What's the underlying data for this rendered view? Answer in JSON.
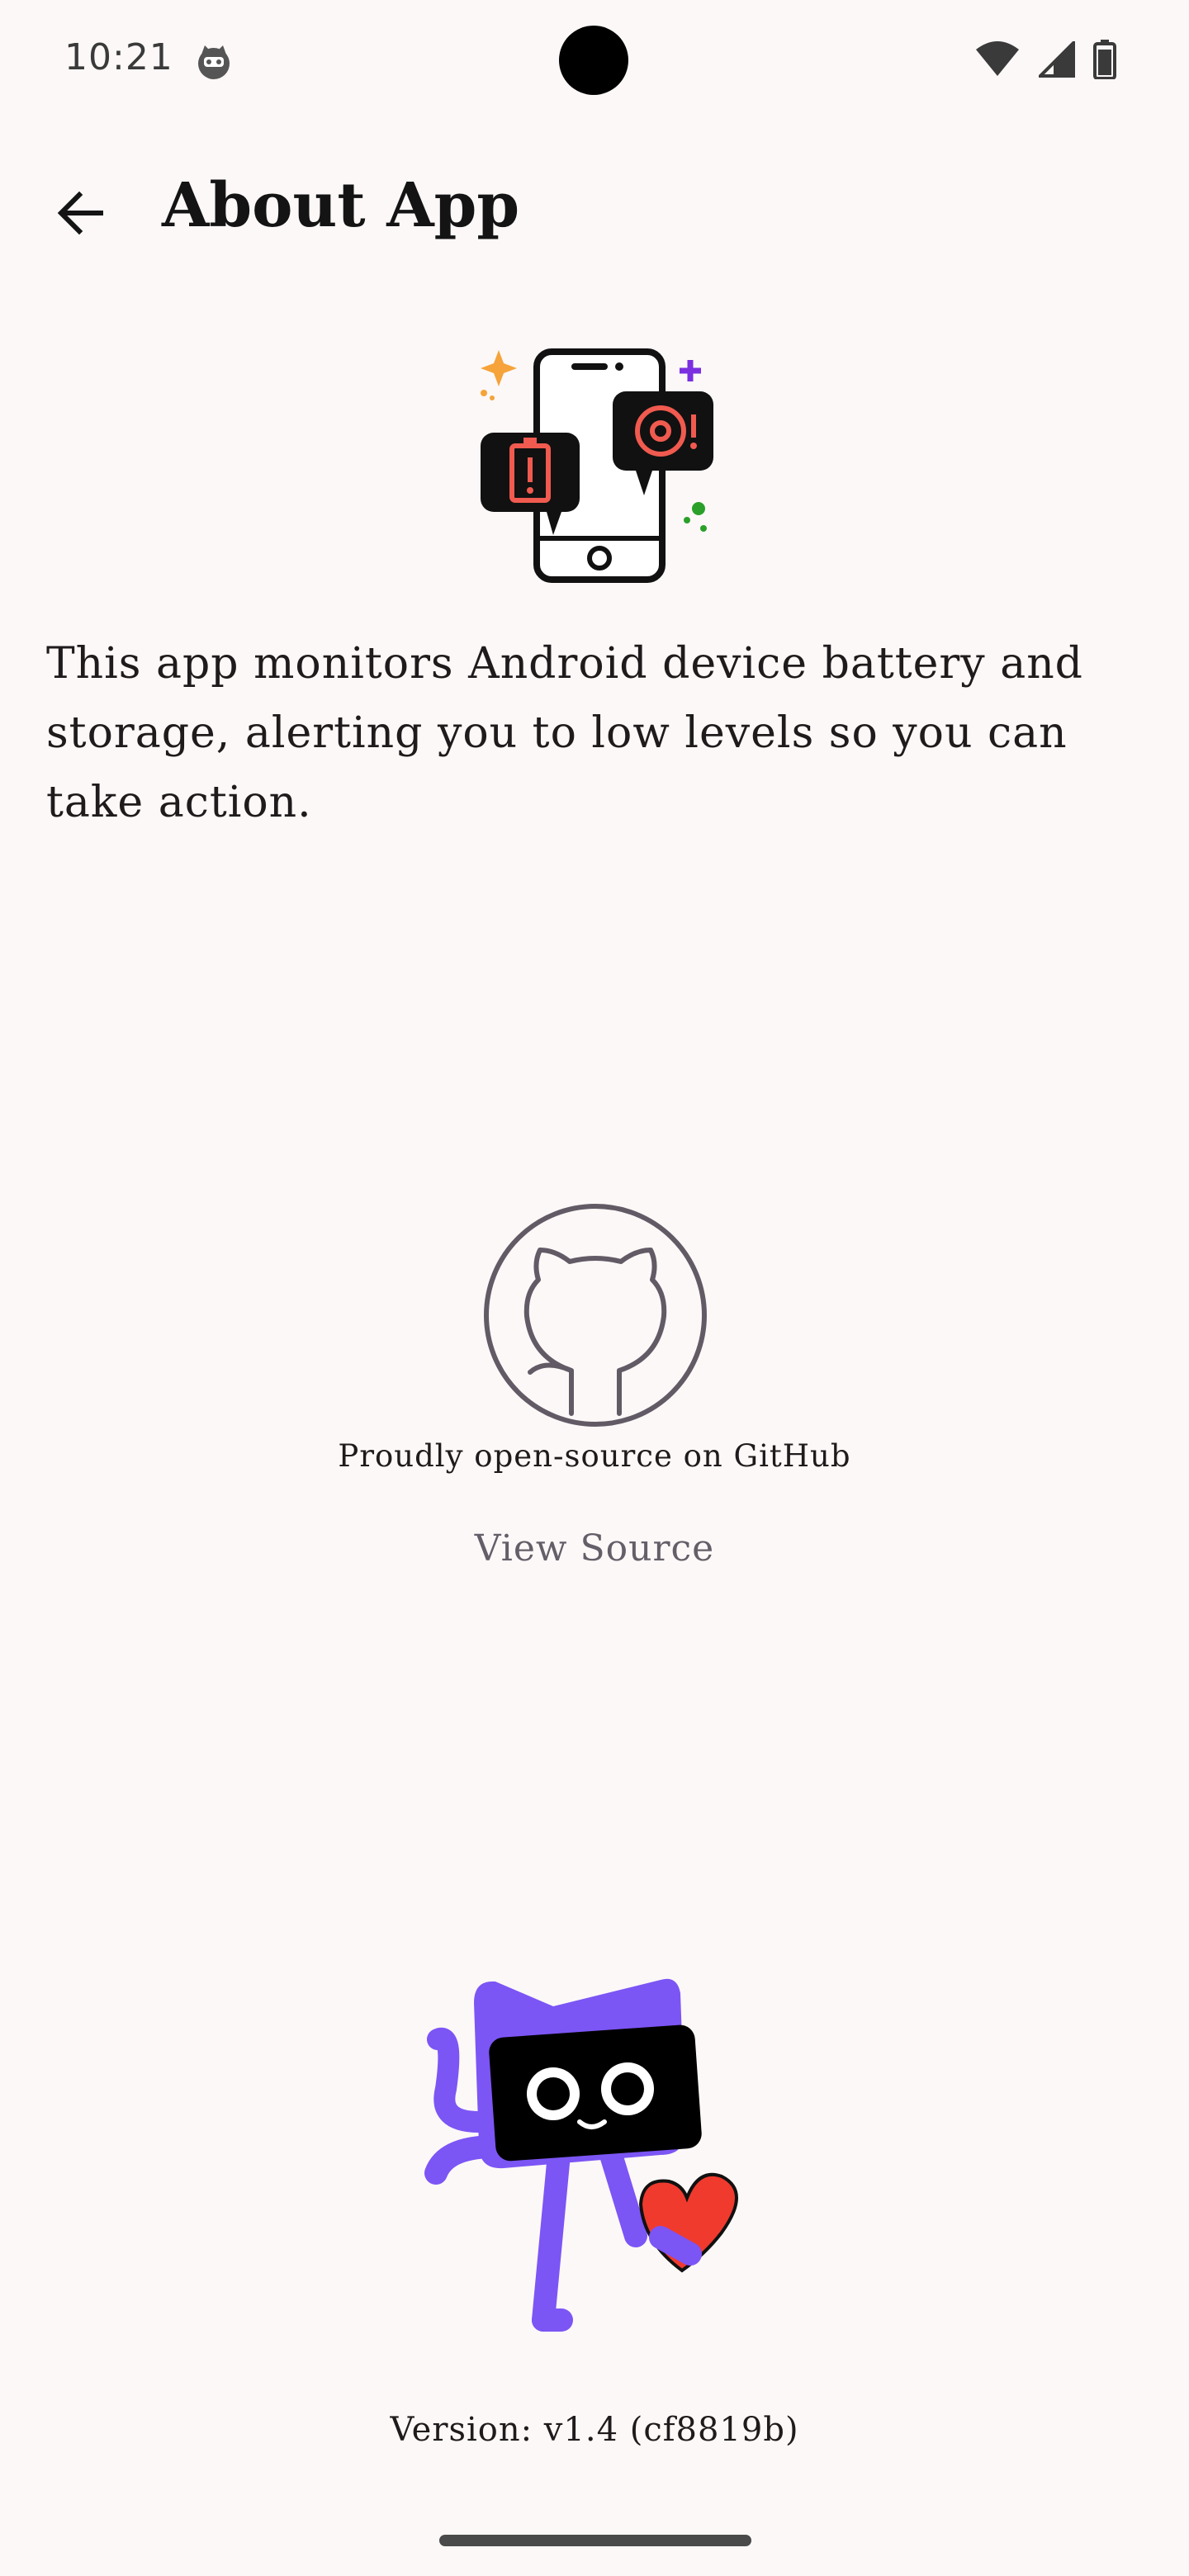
{
  "status_bar": {
    "time": "10:21",
    "icons": [
      "cat-notification-icon",
      "wifi-icon",
      "signal-icon",
      "battery-icon"
    ]
  },
  "app_bar": {
    "title": "About App",
    "back_icon": "arrow-back-icon"
  },
  "about": {
    "illustration": "phone-alerts-illustration",
    "description": "This app monitors Android device battery and storage, alerting you to low levels so you can take action."
  },
  "github": {
    "icon": "github-icon",
    "caption": "Proudly open-source on GitHub",
    "view_source_label": "View Source"
  },
  "mascot": {
    "icon": "cat-mascot-heart-illustration"
  },
  "footer": {
    "version": "Version: v1.4 (cf8819b)"
  },
  "colors": {
    "background": "#fcf8f7",
    "text": "#1f1a1b",
    "link": "#645e69",
    "mascot_purple": "#7c55f5",
    "heart_red": "#f03a2e",
    "alert_red": "#f05a4f"
  }
}
